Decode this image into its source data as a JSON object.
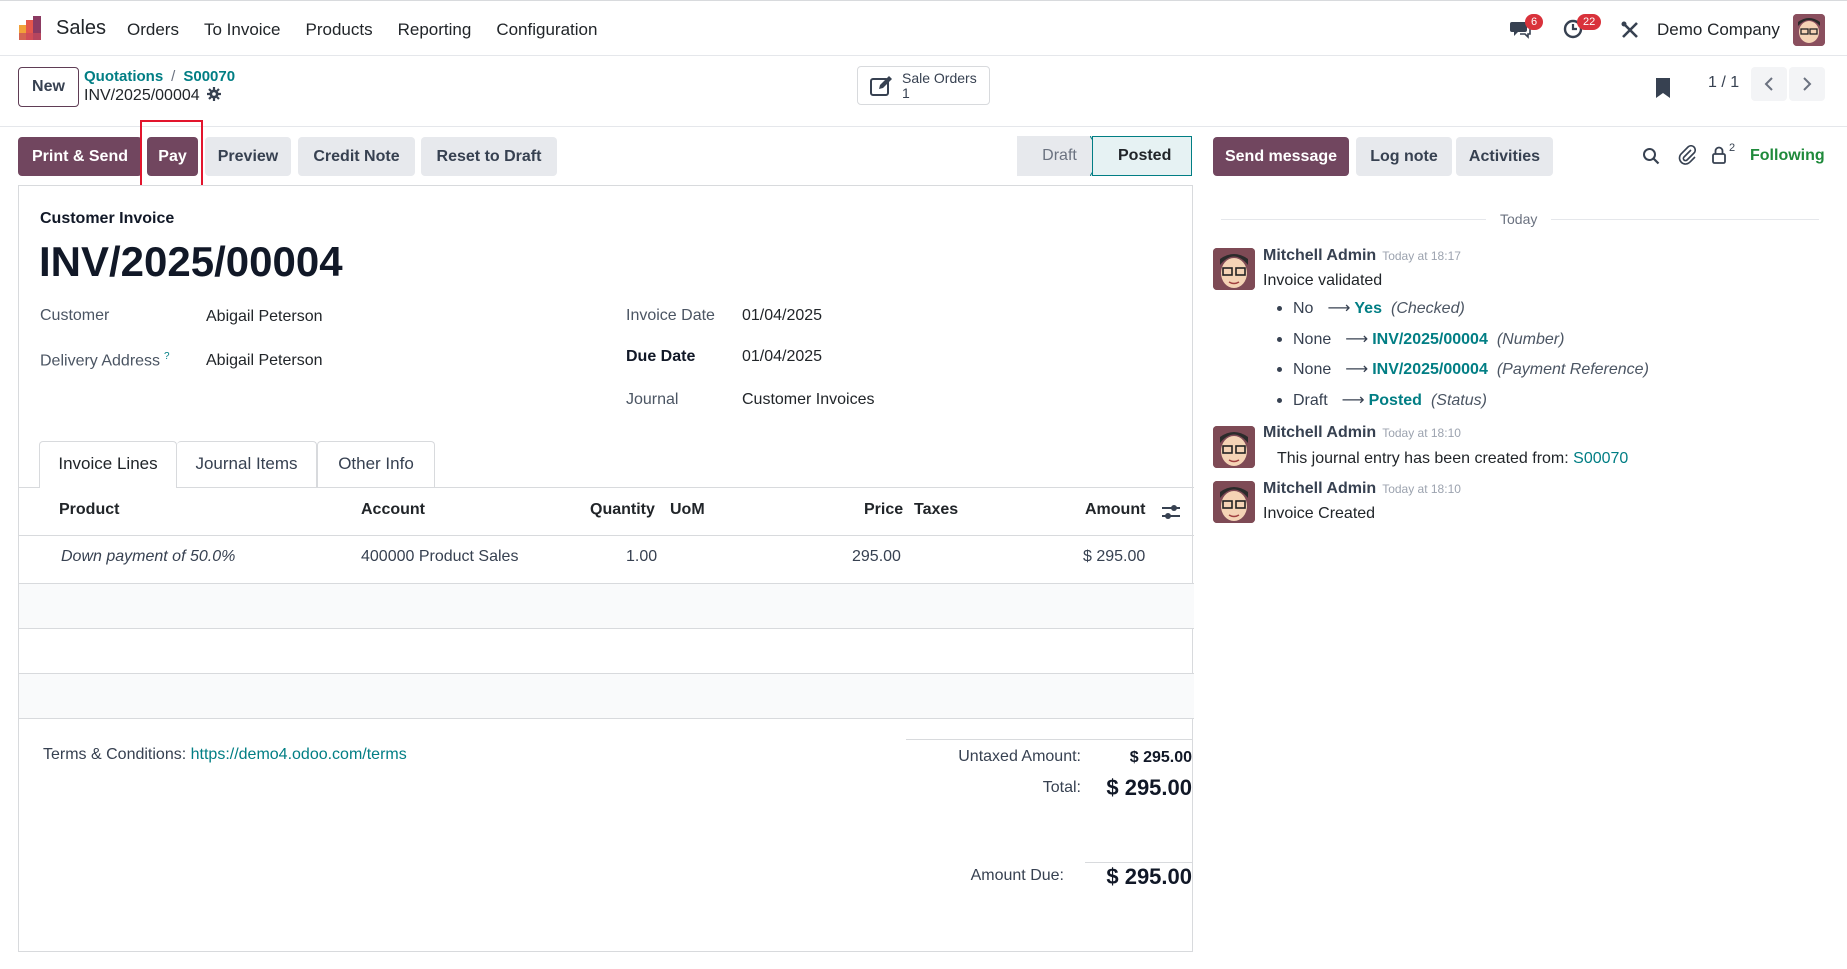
{
  "navbar": {
    "app_name": "Sales",
    "menu": [
      "Orders",
      "To Invoice",
      "Products",
      "Reporting",
      "Configuration"
    ],
    "messages_count": "6",
    "activities_count": "22",
    "company": "Demo Company"
  },
  "control_panel": {
    "new_label": "New",
    "breadcrumb": [
      "Quotations",
      "S00070"
    ],
    "record_name": "INV/2025/00004",
    "smart_button": {
      "label": "Sale Orders",
      "count": "1"
    },
    "pager": "1 / 1"
  },
  "actions": {
    "print_send": "Print & Send",
    "pay": "Pay",
    "preview": "Preview",
    "credit_note": "Credit Note",
    "reset_draft": "Reset to Draft"
  },
  "statusbar": {
    "draft": "Draft",
    "posted": "Posted"
  },
  "invoice": {
    "doc_type": "Customer Invoice",
    "number": "INV/2025/00004",
    "customer_label": "Customer",
    "customer": "Abigail Peterson",
    "delivery_label": "Delivery Address",
    "delivery_help": "?",
    "delivery": "Abigail Peterson",
    "invoice_date_label": "Invoice Date",
    "invoice_date": "01/04/2025",
    "due_date_label": "Due Date",
    "due_date": "01/04/2025",
    "journal_label": "Journal",
    "journal": "Customer Invoices"
  },
  "tabs": [
    "Invoice Lines",
    "Journal Items",
    "Other Info"
  ],
  "lines": {
    "headers": {
      "product": "Product",
      "account": "Account",
      "quantity": "Quantity",
      "uom": "UoM",
      "price": "Price",
      "taxes": "Taxes",
      "amount": "Amount"
    },
    "rows": [
      {
        "product": "Down payment of 50.0%",
        "account": "400000 Product Sales",
        "quantity": "1.00",
        "uom": "",
        "price": "295.00",
        "taxes": "",
        "amount": "$ 295.00"
      }
    ]
  },
  "footer": {
    "terms_label": "Terms & Conditions:",
    "terms_link": "https://demo4.odoo.com/terms",
    "untaxed_label": "Untaxed Amount:",
    "untaxed": "$ 295.00",
    "total_label": "Total:",
    "total": "$ 295.00",
    "due_label": "Amount Due:",
    "due": "$ 295.00"
  },
  "chatter": {
    "send_message": "Send message",
    "log_note": "Log note",
    "activities": "Activities",
    "followers_count": "2",
    "following": "Following",
    "today": "Today",
    "messages": [
      {
        "author": "Mitchell Admin",
        "time": "Today at 18:17",
        "body": "Invoice validated",
        "tracking": [
          {
            "old": "No",
            "new": "Yes",
            "field": "(Checked)"
          },
          {
            "old": "None",
            "new": "INV/2025/00004",
            "field": "(Number)"
          },
          {
            "old": "None",
            "new": "INV/2025/00004",
            "field": "(Payment Reference)"
          },
          {
            "old": "Draft",
            "new": "Posted",
            "field": "(Status)"
          }
        ]
      },
      {
        "author": "Mitchell Admin",
        "time": "Today at 18:10",
        "body": "This journal entry has been created from:",
        "link": "S00070"
      },
      {
        "author": "Mitchell Admin",
        "time": "Today at 18:10",
        "body": "Invoice Created"
      }
    ]
  },
  "colors": {
    "primary": "#71465f",
    "link": "#017e84",
    "badge": "#d9323b",
    "highlight": "#e2152d"
  }
}
